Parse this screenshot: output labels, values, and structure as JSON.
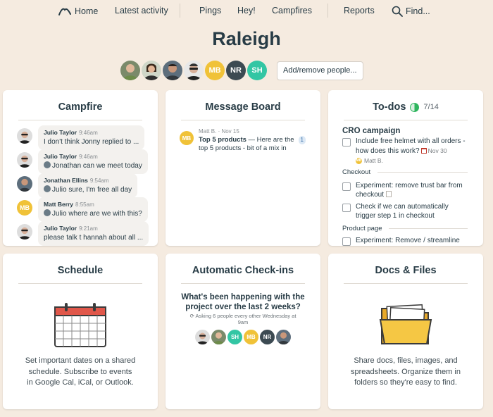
{
  "nav": {
    "home": "Home",
    "latest": "Latest activity",
    "pings": "Pings",
    "hey": "Hey!",
    "campfires": "Campfires",
    "reports": "Reports",
    "find": "Find..."
  },
  "project": {
    "title": "Raleigh",
    "people": [
      {
        "type": "photo"
      },
      {
        "type": "photo"
      },
      {
        "type": "photo"
      },
      {
        "type": "photo"
      },
      {
        "initials": "MB"
      },
      {
        "initials": "NR"
      },
      {
        "initials": "SH"
      }
    ],
    "add_people_label": "Add/remove people..."
  },
  "campfire": {
    "title": "Campfire",
    "messages": [
      {
        "author": "Julio Taylor",
        "time": "9:46am",
        "text": "I don't think Jonny replied to ..."
      },
      {
        "author": "Julio Taylor",
        "time": "9:46am",
        "text": "Jonathan can we meet today"
      },
      {
        "author": "Jonathan Ellins",
        "time": "9:54am",
        "text": "Julio sure, I'm free all day"
      },
      {
        "author": "Matt Berry",
        "time": "8:55am",
        "text": "Julio where are we with this?",
        "initials": "MB"
      },
      {
        "author": "Julio Taylor",
        "time": "9:21am",
        "text": "please talk t hannah about all ..."
      }
    ]
  },
  "message_board": {
    "title": "Message Board",
    "post": {
      "meta": "Matt B. · Nov 15",
      "subject": "Top 5 products",
      "excerpt_inline": " — Here are the",
      "excerpt_line2": "top 5 products - bit of a mix in",
      "comments": "1",
      "initials": "MB"
    }
  },
  "todos": {
    "title": "To-dos",
    "progress": "7/14",
    "progress_fraction": 0.5,
    "list_name": "CRO campaign",
    "items": [
      {
        "text_1": "Include free helmet with all orders -",
        "text_2": "how does this work?",
        "due": "Nov 30",
        "assignee": "Matt B.",
        "assignee_initials": "MB"
      }
    ],
    "groups": [
      {
        "label": "Checkout",
        "items": [
          {
            "text_1": "Experiment: remove trust bar from",
            "text_2": "checkout"
          },
          {
            "text_1": "Check if we can automatically",
            "text_2": "trigger step 1 in checkout"
          }
        ]
      },
      {
        "label": "Product page",
        "items": [
          {
            "text_1": "Experiment: Remove / streamline"
          }
        ]
      }
    ]
  },
  "schedule": {
    "title": "Schedule",
    "desc_1": "Set important dates on a shared",
    "desc_2": "schedule. Subscribe to events",
    "desc_3": "in Google Cal, iCal, or Outlook."
  },
  "checkins": {
    "title": "Automatic Check-ins",
    "question_1": "What's been happening with the",
    "question_2": "project over the last 2 weeks?",
    "sub_1": "Asking 6 people every other Wednesday at",
    "sub_2": "9am",
    "people": [
      {
        "type": "photo"
      },
      {
        "type": "photo"
      },
      {
        "initials": "SH"
      },
      {
        "initials": "MB"
      },
      {
        "initials": "NR"
      },
      {
        "type": "photo"
      }
    ]
  },
  "docs": {
    "title": "Docs & Files",
    "desc_1": "Share docs, files, images, and",
    "desc_2": "spreadsheets. Organize them in",
    "desc_3": "folders so they're easy to find."
  },
  "colors": {
    "background": "#f5ebe0",
    "mb": "#f0c238",
    "nr": "#3c4a52",
    "sh": "#33c6a4",
    "progress": "#2db55d"
  }
}
